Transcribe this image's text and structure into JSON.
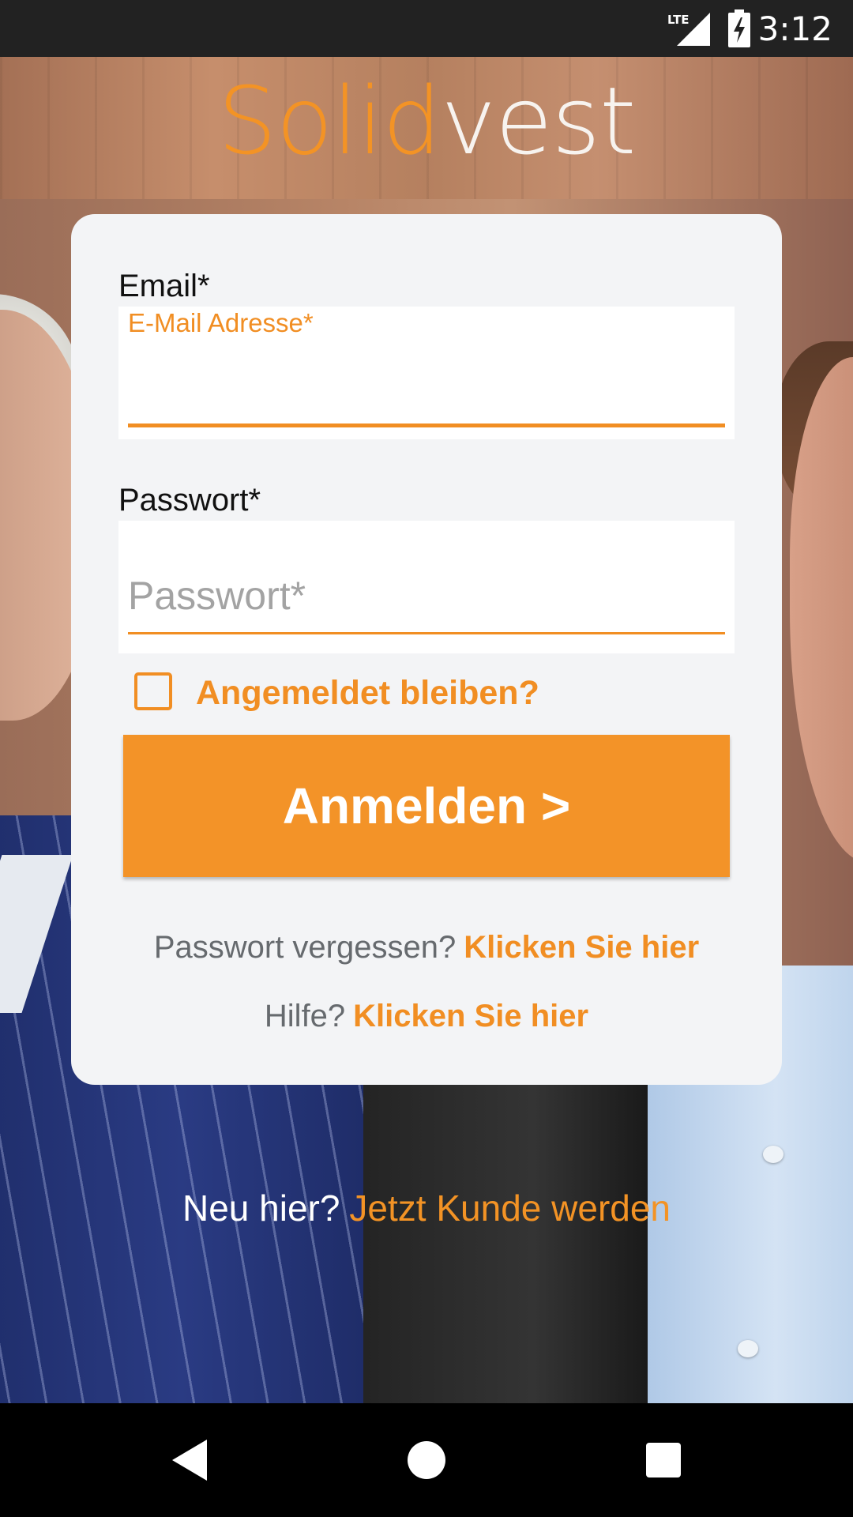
{
  "status_bar": {
    "time": "3:12",
    "network": "LTE",
    "icons": [
      "lte-signal-icon",
      "battery-charging-icon"
    ]
  },
  "logo": {
    "part1": "Solid",
    "part2": "vest"
  },
  "form": {
    "email": {
      "label": "Email*",
      "floating_label": "E-Mail Adresse*",
      "value": ""
    },
    "password": {
      "label": "Passwort*",
      "placeholder": "Passwort*",
      "value": ""
    },
    "remember": {
      "label": "Angemeldet bleiben?",
      "checked": false
    },
    "login_button": "Anmelden >",
    "forgot": {
      "question": "Passwort vergessen?",
      "link": "Klicken Sie hier"
    },
    "help": {
      "question": "Hilfe?",
      "link": "Klicken Sie hier"
    }
  },
  "signup": {
    "question": "Neu hier?",
    "link": "Jetzt Kunde werden"
  },
  "colors": {
    "accent": "#f39325",
    "card": "#f3f4f6",
    "status_bar": "#222222"
  },
  "nav_bar": {
    "icons": [
      "back-icon",
      "home-icon",
      "recent-apps-icon"
    ]
  }
}
